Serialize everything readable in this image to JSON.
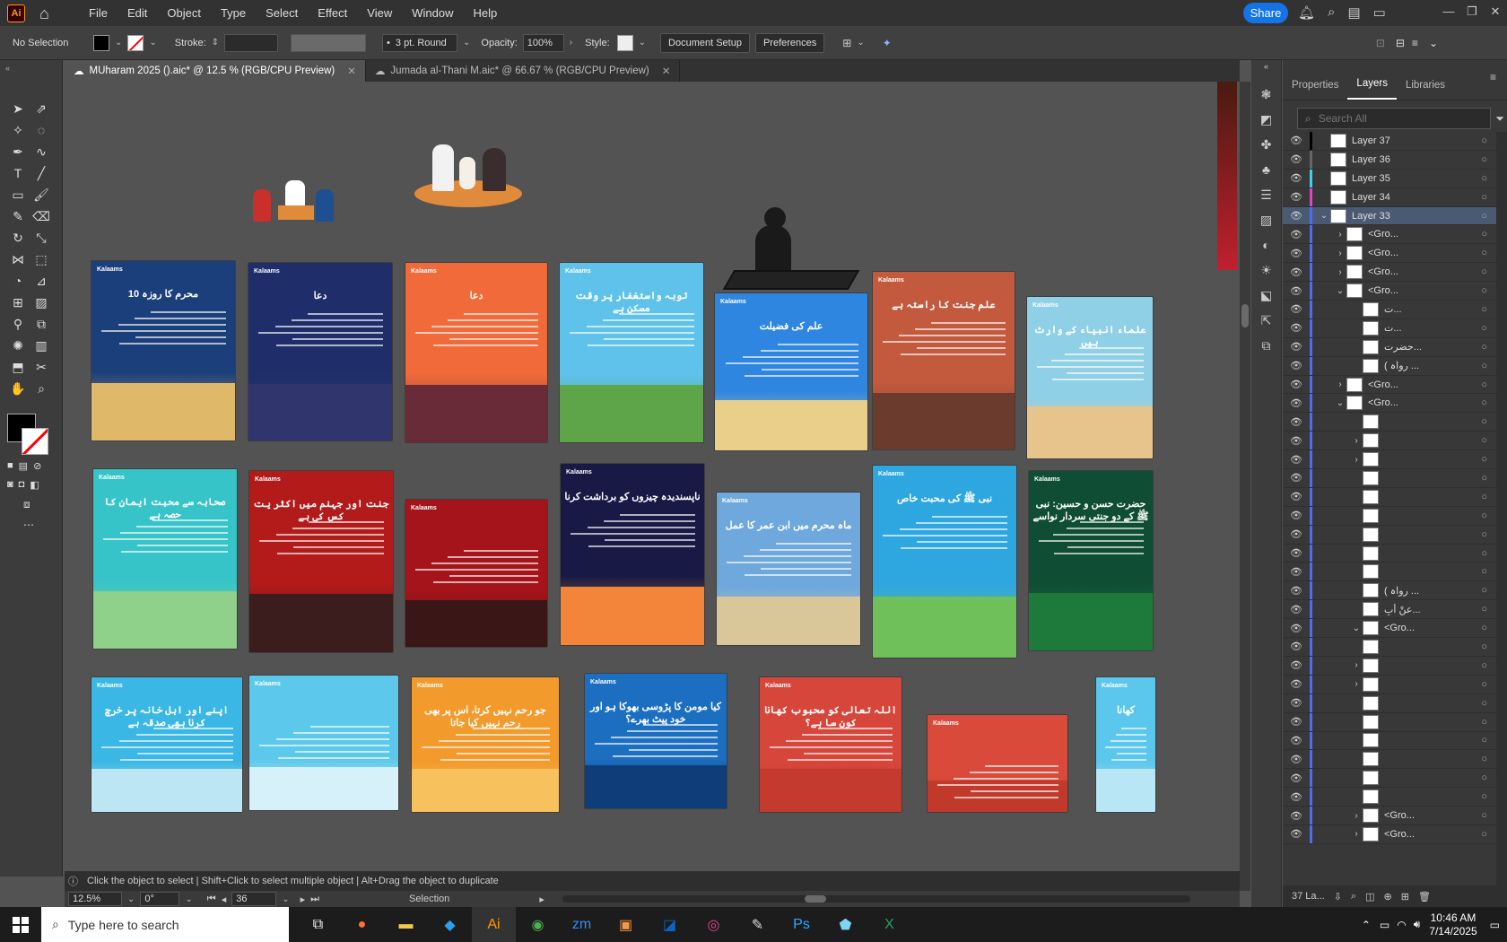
{
  "app": {
    "logo": "Ai"
  },
  "menu": [
    "File",
    "Edit",
    "Object",
    "Type",
    "Select",
    "Effect",
    "View",
    "Window",
    "Help"
  ],
  "share_label": "Share",
  "control_bar": {
    "selection": "No Selection",
    "stroke_label": "Stroke:",
    "brush": "3 pt. Round",
    "opacity_label": "Opacity:",
    "opacity_value": "100%",
    "style_label": "Style:",
    "document_setup": "Document Setup",
    "preferences": "Preferences"
  },
  "tabs": [
    {
      "label": "MUharam 2025 ().aic* @ 12.5 % (RGB/CPU Preview)",
      "active": true
    },
    {
      "label": "Jumada al-Thani M.aic* @ 66.67 % (RGB/CPU Preview)",
      "active": false
    }
  ],
  "artboards": [
    {
      "title": "10 محرم کا روزہ",
      "color": "#1b3f7a",
      "ground": "#e0b86a"
    },
    {
      "title": "دعا",
      "color": "#1f2e6b",
      "ground": "#30356d"
    },
    {
      "title": "دعا",
      "color": "#f06a3a",
      "ground": "#6a2b38"
    },
    {
      "title": "توبہ واستغفار پر وقت مسکن ہے",
      "color": "#5fc2ea",
      "ground": "#5ea54a"
    },
    {
      "title": "علم کی فضیلت",
      "color": "#2e86e0",
      "ground": "#e9cf8a"
    },
    {
      "title": "علم جنت کا راستہ ہے",
      "color": "#c35a3d",
      "ground": "#6b3b2e"
    },
    {
      "title": "علماء انبیاء کے وارث ہیں",
      "color": "#8fd0e6",
      "ground": "#e7c48c"
    },
    {
      "title": "صحابہ سے محبت ایمان کا حصہ ہے",
      "color": "#36c4c8",
      "ground": "#8fd08a"
    },
    {
      "title": "جنت اور جہنم میں اکثر یت کس کی ہے",
      "color": "#b31a1a",
      "ground": "#3b1d1d"
    },
    {
      "title": "",
      "color": "#a5141a",
      "ground": "#3a1616"
    },
    {
      "title": "ناپسندیدہ چیزوں کو برداشت کرنا",
      "color": "#181a45",
      "ground": "#f2853a"
    },
    {
      "title": "ماہ محرم میں ابن عمر کا عمل",
      "color": "#6ea8dc",
      "ground": "#d9c79a"
    },
    {
      "title": "نبی ﷺ کی محبت خاص",
      "color": "#2ea7e0",
      "ground": "#6fbf5a"
    },
    {
      "title": "حضرت حسن و حسین: نبی ﷺ کے دو جنتی سردار نواسے",
      "color": "#0f4d35",
      "ground": "#1e7a3a"
    },
    {
      "title": "اپنے اور اہل خانہ پر خرچ کرنا بھی صدقہ ہے",
      "color": "#3ab7e4",
      "ground": "#bce6f3"
    },
    {
      "title": "",
      "color": "#5cc8ec",
      "ground": "#d7f1fa"
    },
    {
      "title": "جو رحم نہیں کرتا، اس پر بھی رحم نہیں کیا جاتا",
      "color": "#f39a2c",
      "ground": "#f7c25e"
    },
    {
      "title": "کیا مومن کا پڑوسی بھوکا ہو اور خود پیٹ بھرے؟",
      "color": "#1c6fc0",
      "ground": "#0f3d7a"
    },
    {
      "title": "اللہ تعالی کو محبوب کھانا کون سا ہے؟",
      "color": "#d7463a",
      "ground": "#c43a2f"
    },
    {
      "title": "",
      "color": "#d94a3a",
      "ground": "#c0392b"
    },
    {
      "title": "کھانا",
      "color": "#5cc7ec",
      "ground": "#b8e6f5"
    }
  ],
  "status": {
    "hint": "Click the object to select  |  Shift+Click to select multiple object  |  Alt+Drag the object to duplicate",
    "zoom": "12.5%",
    "rotate": "0°",
    "artboard": "36",
    "tool": "Selection"
  },
  "panel": {
    "tabs": [
      "Properties",
      "Layers",
      "Libraries"
    ],
    "search_placeholder": "Search All",
    "footer": "37 La...",
    "layers": [
      {
        "name": "Layer 37",
        "color": "#000000",
        "arrow": "",
        "sel": false
      },
      {
        "name": "Layer 36",
        "color": "#666666",
        "arrow": "",
        "sel": false
      },
      {
        "name": "Layer 35",
        "color": "#3fd0f0",
        "arrow": "",
        "sel": false
      },
      {
        "name": "Layer 34",
        "color": "#d946c8",
        "arrow": "",
        "sel": false
      },
      {
        "name": "Layer 33",
        "color": "#4e6cf0",
        "arrow": "⌄",
        "sel": true
      },
      {
        "name": "<Gro...",
        "color": "#4e6cf0",
        "arrow": "›",
        "sel": false
      },
      {
        "name": "<Gro...",
        "color": "#4e6cf0",
        "arrow": "›",
        "sel": false
      },
      {
        "name": "<Gro...",
        "color": "#4e6cf0",
        "arrow": "›",
        "sel": false
      },
      {
        "name": "<Gro...",
        "color": "#4e6cf0",
        "arrow": "⌄",
        "sel": false
      },
      {
        "name": "ت...",
        "color": "#4e6cf0",
        "arrow": "",
        "sel": false
      },
      {
        "name": "ت...",
        "color": "#4e6cf0",
        "arrow": "",
        "sel": false
      },
      {
        "name": "حضرت...",
        "color": "#4e6cf0",
        "arrow": "",
        "sel": false
      },
      {
        "name": "( رواہ ...",
        "color": "#4e6cf0",
        "arrow": "",
        "sel": false
      },
      {
        "name": "<Gro...",
        "color": "#4e6cf0",
        "arrow": "›",
        "sel": false
      },
      {
        "name": "<Gro...",
        "color": "#4e6cf0",
        "arrow": "⌄",
        "sel": false
      },
      {
        "name": "",
        "color": "#4e6cf0",
        "arrow": "",
        "sel": false
      },
      {
        "name": "",
        "color": "#4e6cf0",
        "arrow": "›",
        "sel": false
      },
      {
        "name": "",
        "color": "#4e6cf0",
        "arrow": "›",
        "sel": false
      },
      {
        "name": "",
        "color": "#4e6cf0",
        "arrow": "",
        "sel": false
      },
      {
        "name": "",
        "color": "#4e6cf0",
        "arrow": "",
        "sel": false
      },
      {
        "name": "",
        "color": "#4e6cf0",
        "arrow": "",
        "sel": false
      },
      {
        "name": "",
        "color": "#4e6cf0",
        "arrow": "",
        "sel": false
      },
      {
        "name": "",
        "color": "#4e6cf0",
        "arrow": "",
        "sel": false
      },
      {
        "name": "",
        "color": "#4e6cf0",
        "arrow": "",
        "sel": false
      },
      {
        "name": "( رواہ ...",
        "color": "#4e6cf0",
        "arrow": "",
        "sel": false
      },
      {
        "name": "عنْ أَبِ...",
        "color": "#4e6cf0",
        "arrow": "",
        "sel": false
      },
      {
        "name": "<Gro...",
        "color": "#4e6cf0",
        "arrow": "⌄",
        "sel": false
      },
      {
        "name": "",
        "color": "#4e6cf0",
        "arrow": "",
        "sel": false
      },
      {
        "name": "",
        "color": "#4e6cf0",
        "arrow": "›",
        "sel": false
      },
      {
        "name": "",
        "color": "#4e6cf0",
        "arrow": "›",
        "sel": false
      },
      {
        "name": "",
        "color": "#4e6cf0",
        "arrow": "",
        "sel": false
      },
      {
        "name": "",
        "color": "#4e6cf0",
        "arrow": "",
        "sel": false
      },
      {
        "name": "",
        "color": "#4e6cf0",
        "arrow": "",
        "sel": false
      },
      {
        "name": "",
        "color": "#4e6cf0",
        "arrow": "",
        "sel": false
      },
      {
        "name": "",
        "color": "#4e6cf0",
        "arrow": "",
        "sel": false
      },
      {
        "name": "",
        "color": "#4e6cf0",
        "arrow": "",
        "sel": false
      },
      {
        "name": "<Gro...",
        "color": "#4e6cf0",
        "arrow": "›",
        "sel": false
      },
      {
        "name": "<Gro...",
        "color": "#4e6cf0",
        "arrow": "›",
        "sel": false
      }
    ]
  },
  "taskbar": {
    "search_placeholder": "Type here to search",
    "time": "10:46 AM",
    "date": "7/14/2025"
  }
}
